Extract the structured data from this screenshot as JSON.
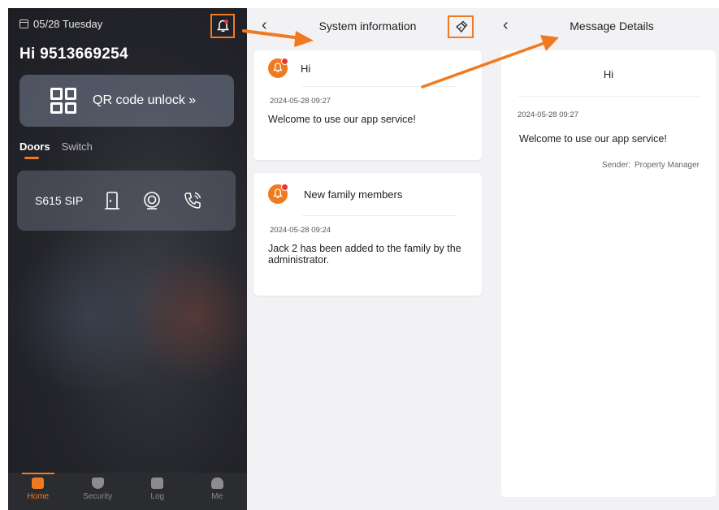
{
  "colors": {
    "accent": "#f07a22",
    "badge": "#e53935",
    "home_bg": "#24252b",
    "panel_bg": "#f2f2f4"
  },
  "home": {
    "date": "05/28 Tuesday",
    "greeting": "Hi 9513669254",
    "qr_label": "QR code unlock »",
    "tabs": [
      "Doors",
      "Switch"
    ],
    "device": {
      "name": "S615 SIP",
      "icons": [
        "door-icon",
        "camera-icon",
        "phone-call-icon"
      ]
    },
    "tabbar": [
      {
        "label": "Home",
        "icon": "home-icon"
      },
      {
        "label": "Security",
        "icon": "shield-icon"
      },
      {
        "label": "Log",
        "icon": "log-icon"
      },
      {
        "label": "Me",
        "icon": "user-icon"
      }
    ]
  },
  "sysinfo": {
    "title": "System information",
    "messages": [
      {
        "title": "Hi",
        "time": "2024-05-28  09:27",
        "body": "Welcome to use our app service!"
      },
      {
        "title": "New family members",
        "time": "2024-05-28  09:24",
        "body": "Jack 2 has been added to the family by the administrator."
      }
    ]
  },
  "details": {
    "title": "Message Details",
    "msg_title": "Hi",
    "time": "2024-05-28  09:27",
    "body": "Welcome to use our app service!",
    "sender_label": "Sender:",
    "sender": "Property Manager"
  }
}
